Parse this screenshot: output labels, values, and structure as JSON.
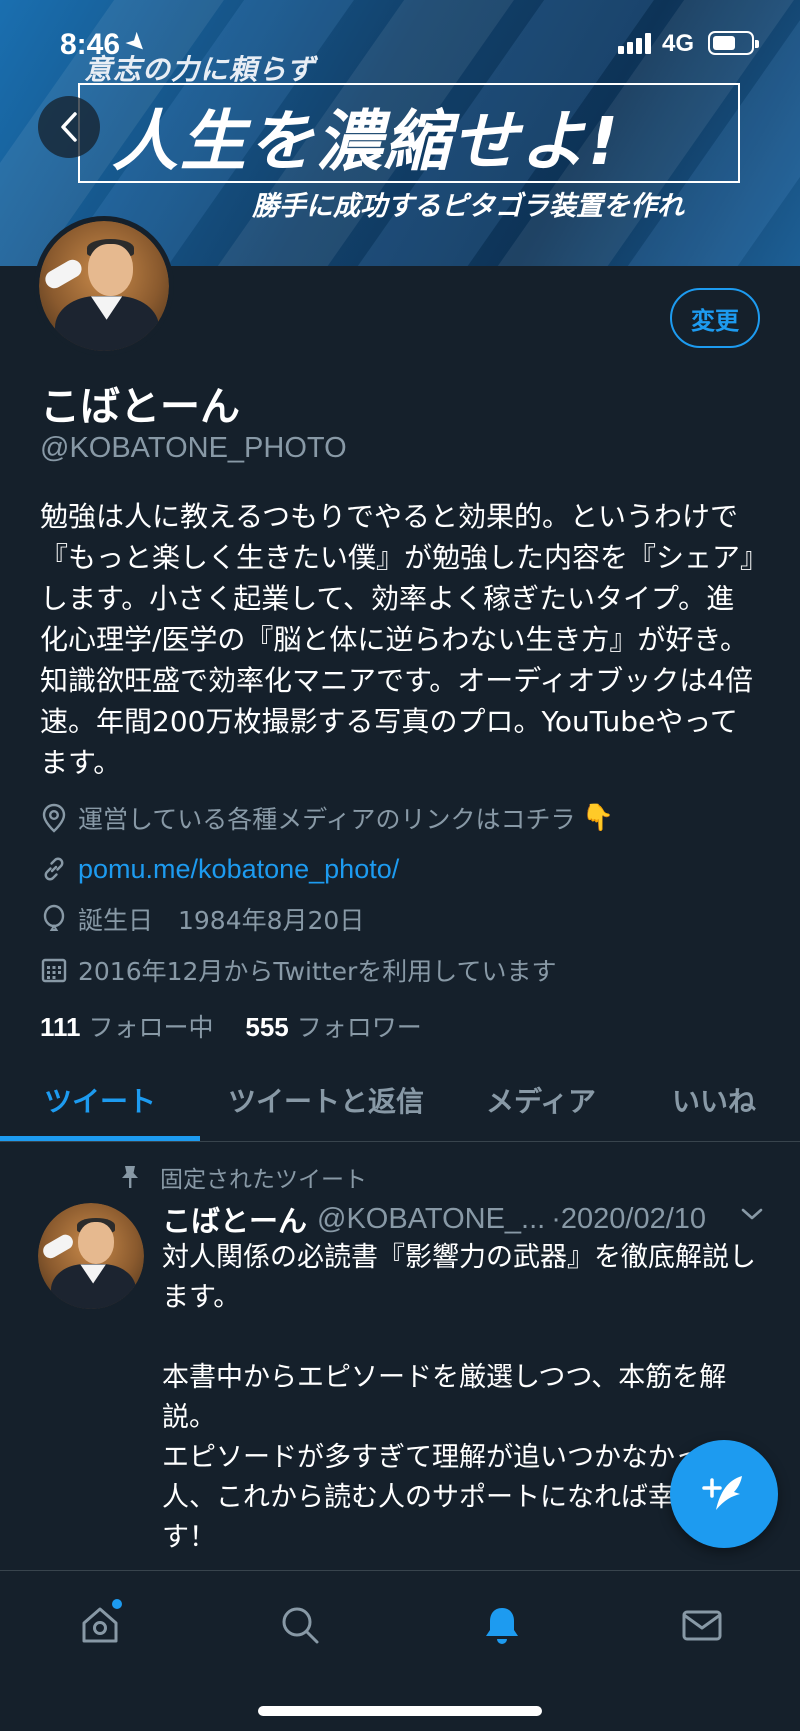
{
  "status_bar": {
    "time": "8:46",
    "network": "4G"
  },
  "banner": {
    "kicker": "意志の力に頼らず",
    "headline": "人生を濃縮せよ!",
    "subline": "勝手に成功するピタゴラ装置を作れ"
  },
  "profile": {
    "display_name": "こばとーん",
    "handle": "@KOBATONE_PHOTO",
    "edit_button_label": "変更",
    "bio": "勉強は人に教えるつもりでやると効果的。というわけで『もっと楽しく生きたい僕』が勉強した内容を『シェア』します。小さく起業して、効率よく稼ぎたいタイプ。進化心理学/医学の『脳と体に逆らわない生き方』が好き。知識欲旺盛で効率化マニアです。オーディオブックは4倍速。年間200万枚撮影する写真のプロ。YouTubeやってます。",
    "location": "運営している各種メディアのリンクはコチラ",
    "location_emoji": "👇",
    "website": "pomu.me/kobatone_photo/",
    "birthday": "誕生日　1984年8月20日",
    "joined": "2016年12月からTwitterを利用しています",
    "following_count": "111",
    "following_label": "フォロー中",
    "followers_count": "555",
    "followers_label": "フォロワー"
  },
  "tabs": [
    {
      "label": "ツイート",
      "active": true
    },
    {
      "label": "ツイートと返信",
      "active": false
    },
    {
      "label": "メディア",
      "active": false
    },
    {
      "label": "いいね",
      "active": false
    }
  ],
  "pinned_tweet": {
    "pinned_label": "固定されたツイート",
    "author_name": "こばとーん",
    "author_handle": "@KOBATONE_...",
    "date": "·2020/02/10",
    "text": "対人関係の必読書『影響力の武器』を徹底解説します。\n\n本書中からエピソードを厳選しつつ、本筋を解説。\nエピソードが多すぎて理解が追いつかなかった人、これから読む人のサポートになれば幸いです！"
  },
  "bottom_nav": [
    "home-icon",
    "search-icon",
    "notifications-icon",
    "messages-icon"
  ],
  "colors": {
    "background": "#15202b",
    "accent": "#1d9bf0",
    "secondary_text": "#8899a6",
    "divider": "#38444d"
  }
}
